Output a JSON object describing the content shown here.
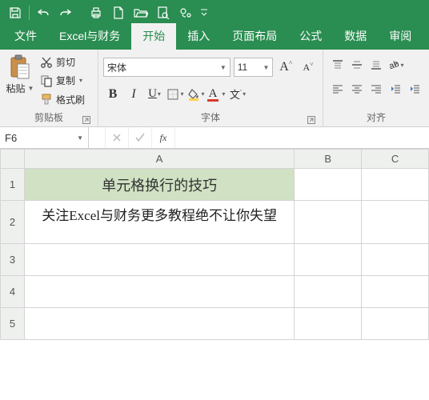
{
  "qat": {
    "save": "save",
    "undo": "undo",
    "redo": "redo",
    "print": "print",
    "new": "new",
    "open": "open",
    "preview": "preview",
    "share": "share"
  },
  "tabs": {
    "file": "文件",
    "excel_finance": "Excel与财务",
    "home": "开始",
    "insert": "插入",
    "page_layout": "页面布局",
    "formulas": "公式",
    "data": "数据",
    "review": "审阅"
  },
  "ribbon": {
    "clipboard": {
      "paste": "粘贴",
      "cut": "剪切",
      "copy": "复制",
      "format_painter": "格式刷",
      "group_label": "剪贴板"
    },
    "font": {
      "name": "宋体",
      "size": "11",
      "grow": "A",
      "shrink": "A",
      "bold": "B",
      "italic": "I",
      "underline": "U",
      "wen": "文",
      "group_label": "字体"
    },
    "align": {
      "group_label": "对齐"
    }
  },
  "formula_bar": {
    "name_box": "F6",
    "fx": "fx",
    "value": ""
  },
  "grid": {
    "cols": {
      "A": "A",
      "B": "B",
      "C": "C"
    },
    "rows": {
      "r1": "1",
      "r2": "2",
      "r3": "3",
      "r4": "4",
      "r5": "5"
    },
    "cells": {
      "A1": "单元格换行的技巧",
      "A2": "关注Excel与财务更多教程绝不让你失望"
    }
  }
}
